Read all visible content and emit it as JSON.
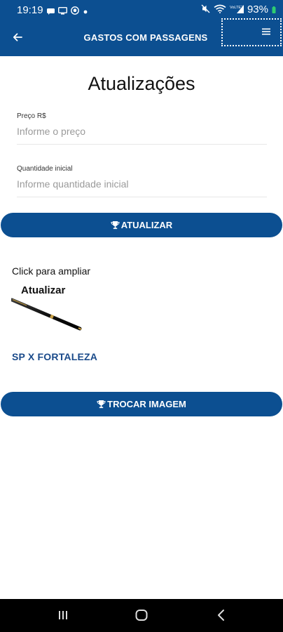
{
  "status_bar": {
    "time": "19:19",
    "battery_percent": "93%",
    "signal_text": "VoLTE2",
    "left_icons": [
      "message-icon",
      "screen-icon",
      "soccer-icon",
      "dot-icon"
    ],
    "right_icons": [
      "mute-icon",
      "wifi-icon",
      "signal-icon",
      "battery-icon"
    ]
  },
  "app_bar": {
    "title": "GASTOS COM PASSAGENS",
    "back_icon": "arrow-left-icon",
    "menu_icon": "hamburger-menu-icon"
  },
  "main": {
    "heading": "Atualizações",
    "fields": {
      "price": {
        "label": "Preço R$",
        "placeholder": "Informe o preço",
        "value": ""
      },
      "quantity": {
        "label": "Quantidade inicial",
        "placeholder": "Informe quantidade inicial",
        "value": ""
      }
    },
    "update_button": {
      "label": "ATUALIZAR",
      "icon": "trophy-icon"
    },
    "click_hint": "Click para ampliar",
    "image": {
      "caption": "Atualizar",
      "depicts": "pen-image"
    },
    "route_link": "SP X FORTALEZA",
    "change_image_button": {
      "label": "TROCAR IMAGEM",
      "icon": "trophy-icon"
    }
  },
  "nav_bar": {
    "buttons": [
      "recent-apps-icon",
      "home-icon",
      "back-icon"
    ]
  },
  "colors": {
    "primary": "#0c4f91",
    "link": "#1a4a8a",
    "navbar": "#000000"
  }
}
